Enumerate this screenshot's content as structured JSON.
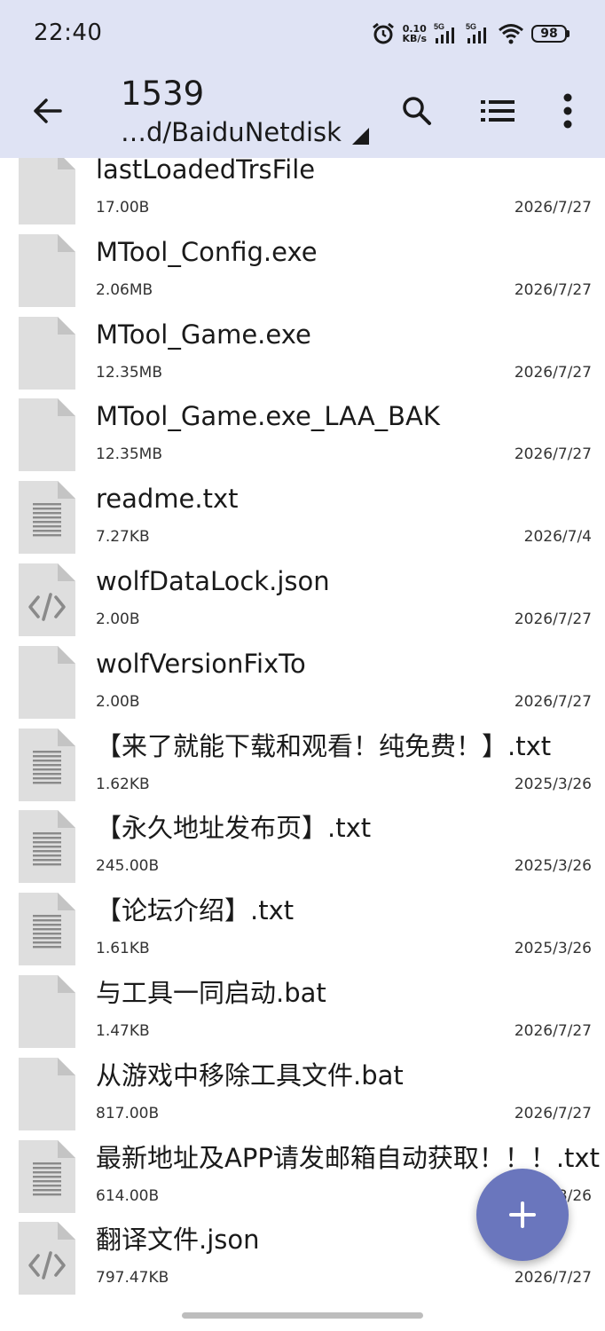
{
  "status_bar": {
    "time": "22:40",
    "net_speed_value": "0.10",
    "net_speed_unit": "KB/s",
    "signal_1": "5G",
    "signal_2": "5G",
    "battery": "98",
    "icons": [
      "alarm-icon",
      "signal-icon",
      "signal-icon",
      "wifi-icon",
      "battery-icon"
    ]
  },
  "toolbar": {
    "title": "1539",
    "path": "…d/BaiduNetdisk",
    "icons": [
      "back-arrow-icon",
      "search-icon",
      "list-view-icon",
      "more-vert-icon"
    ]
  },
  "files": [
    {
      "name": "lastLoadedTrsFile",
      "size": "17.00B",
      "date": "2026/7/27",
      "icon": "file-icon"
    },
    {
      "name": "MTool_Config.exe",
      "size": "2.06MB",
      "date": "2026/7/27",
      "icon": "file-icon"
    },
    {
      "name": "MTool_Game.exe",
      "size": "12.35MB",
      "date": "2026/7/27",
      "icon": "file-icon"
    },
    {
      "name": "MTool_Game.exe_LAA_BAK",
      "size": "12.35MB",
      "date": "2026/7/27",
      "icon": "file-icon"
    },
    {
      "name": "readme.txt",
      "size": "7.27KB",
      "date": "2026/7/4",
      "icon": "text-file-icon"
    },
    {
      "name": "wolfDataLock.json",
      "size": "2.00B",
      "date": "2026/7/27",
      "icon": "code-file-icon"
    },
    {
      "name": "wolfVersionFixTo",
      "size": "2.00B",
      "date": "2026/7/27",
      "icon": "file-icon"
    },
    {
      "name": "【来了就能下载和观看！纯免费！】.txt",
      "size": "1.62KB",
      "date": "2025/3/26",
      "icon": "text-file-icon"
    },
    {
      "name": "【永久地址发布页】.txt",
      "size": "245.00B",
      "date": "2025/3/26",
      "icon": "text-file-icon"
    },
    {
      "name": "【论坛介绍】.txt",
      "size": "1.61KB",
      "date": "2025/3/26",
      "icon": "text-file-icon"
    },
    {
      "name": "与工具一同启动.bat",
      "size": "1.47KB",
      "date": "2026/7/27",
      "icon": "file-icon"
    },
    {
      "name": "从游戏中移除工具文件.bat",
      "size": "817.00B",
      "date": "2026/7/27",
      "icon": "file-icon"
    },
    {
      "name": "最新地址及APP请发邮箱自动获取！！！.txt",
      "size": "614.00B",
      "date": "2025/3/26",
      "icon": "text-file-icon"
    },
    {
      "name": "翻译文件.json",
      "size": "797.47KB",
      "date": "2026/7/27",
      "icon": "code-file-icon"
    }
  ],
  "fab": {
    "icon": "plus-icon"
  },
  "colors": {
    "header_bg": "#dfe3f4",
    "fab_bg": "#6a76bd",
    "icon_gray": "#dedede",
    "icon_fold": "#c4c4c4",
    "icon_glyph": "#8a8a8a"
  }
}
